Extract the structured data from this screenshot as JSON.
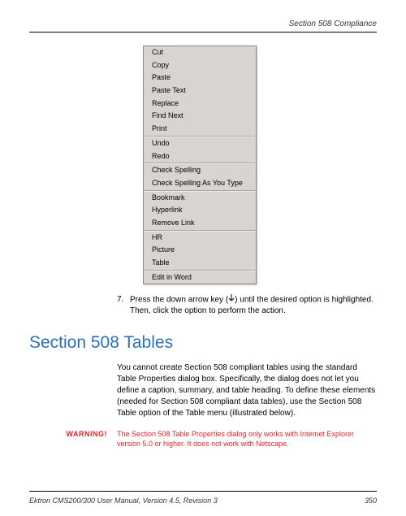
{
  "header": {
    "section_title": "Section 508 Compliance"
  },
  "menu": {
    "groups": [
      [
        "Cut",
        "Copy",
        "Paste",
        "Paste Text",
        "Replace",
        "Find Next",
        "Print"
      ],
      [
        "Undo",
        "Redo"
      ],
      [
        "Check Spelling",
        "Check Spelling As You Type"
      ],
      [
        "Bookmark",
        "Hyperlink",
        "Remove Link"
      ],
      [
        "HR",
        "Picture",
        "Table"
      ],
      [
        "Edit in Word"
      ]
    ]
  },
  "step": {
    "number": "7.",
    "text_before": "Press the down arrow key (",
    "text_after": ") until the desired option is highlighted. Then, click the option to perform the action."
  },
  "heading": "Section 508 Tables",
  "body_para": "You cannot create Section 508 compliant tables using the standard Table Properties dialog box. Specifically, the dialog does not let you define a caption, summary, and table heading. To define these elements (needed for Section 508 compliant data tables), use the Section 508 Table option of the Table menu (illustrated below).",
  "warning": {
    "label": "WARNING!",
    "text": "The Section 508 Table Properties dialog only works with Internet Explorer version 5.0 or higher. It does not work with Netscape."
  },
  "footer": {
    "left": "Ektron CMS200/300 User Manual, Version 4.5, Revision 3",
    "right": "350"
  }
}
